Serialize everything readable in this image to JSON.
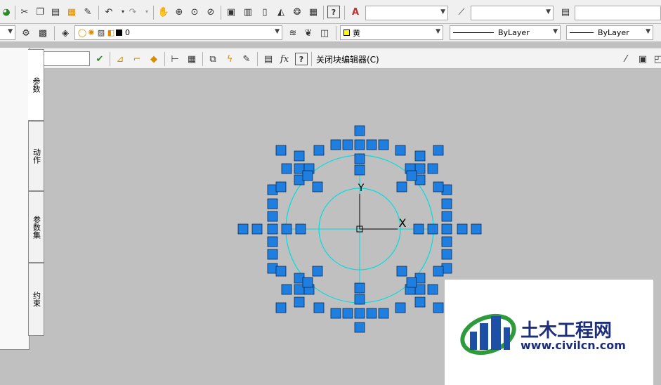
{
  "toolbar1": {
    "icons": [
      "globe-icon",
      "cut-icon",
      "copy-icon",
      "paste-icon",
      "match-properties-icon",
      "brush-icon",
      "undo-icon",
      "redo-icon",
      "pan-icon",
      "zoom-realtime-icon",
      "zoom-window-icon",
      "zoom-previous-icon",
      "properties-icon",
      "design-center-icon",
      "tool-palettes-icon",
      "sheet-set-icon",
      "markup-icon",
      "calculator-icon",
      "help-icon"
    ],
    "text_style_combo": "",
    "dim_style_combo": "",
    "table_style_combo": ""
  },
  "toolbar2": {
    "layer_state_combo": "",
    "layer_combo": "0",
    "color_combo": "黄",
    "linetype_combo": "ByLayer",
    "lineweight_combo": "ByLayer",
    "yellow": "#ffff00"
  },
  "block_editor": {
    "name_input": "",
    "close_label": "关闭块编辑器(C)"
  },
  "palette": {
    "tabs": [
      "参数",
      "动作",
      "参数集",
      "约束"
    ]
  },
  "drawing": {
    "accent": "#1e7fe0",
    "cyan": "#00dddd",
    "axis_y": "Y",
    "axis_x": "X"
  },
  "watermark": {
    "name": "土木工程网",
    "url": "www.civilcn.com"
  }
}
